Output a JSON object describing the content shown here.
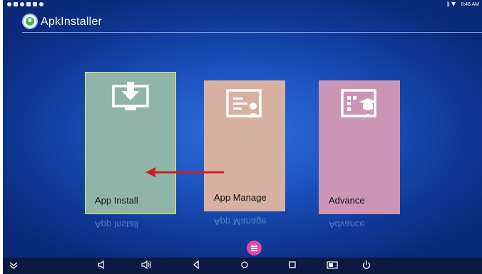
{
  "app": {
    "title": "ApkInstaller"
  },
  "status_bar": {
    "time": "8:46 AM"
  },
  "tiles": [
    {
      "id": "install",
      "label": "App Install",
      "color": "#8fb5a9",
      "icon": "download-monitor-icon",
      "selected": true
    },
    {
      "id": "manage",
      "label": "App Manage",
      "color": "#d6b0a0",
      "icon": "presentation-person-icon",
      "selected": false
    },
    {
      "id": "advance",
      "label": "Advance",
      "color": "#cb95b5",
      "icon": "graduation-board-icon",
      "selected": false
    }
  ],
  "annotation": {
    "type": "arrow",
    "color": "#cc1f1f",
    "direction": "left"
  },
  "menu_button": {
    "icon": "hamburger-menu-icon",
    "color": "#e04aa0"
  },
  "nav_bar": {
    "buttons": [
      "collapse-icon",
      "volume-down-icon",
      "volume-up-icon",
      "back-icon",
      "home-icon",
      "recents-icon",
      "screenshot-icon",
      "power-icon"
    ]
  }
}
